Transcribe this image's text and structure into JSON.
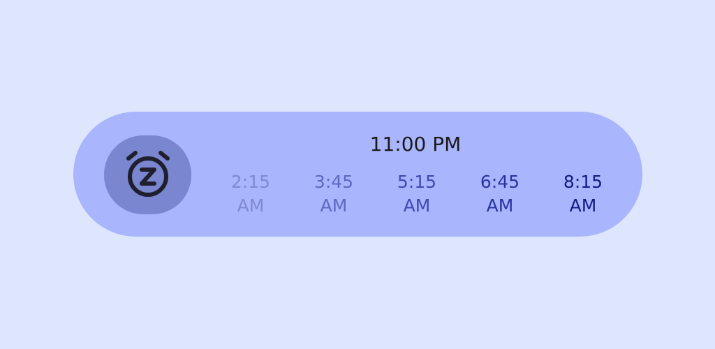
{
  "bedtime": "11:00 PM",
  "icon": "snooze-alarm-icon",
  "wake_times": [
    {
      "time": "2:15",
      "period": "AM",
      "color": "#7f8ad3"
    },
    {
      "time": "3:45",
      "period": "AM",
      "color": "#5e69c2"
    },
    {
      "time": "5:15",
      "period": "AM",
      "color": "#3f4ab3"
    },
    {
      "time": "6:45",
      "period": "AM",
      "color": "#2a34a0"
    },
    {
      "time": "8:15",
      "period": "AM",
      "color": "#151d82"
    }
  ],
  "colors": {
    "background": "#dde6fd",
    "widget": "#a9b5fc",
    "icon_badge": "#7a86d0",
    "icon": "#1f1f2e"
  }
}
